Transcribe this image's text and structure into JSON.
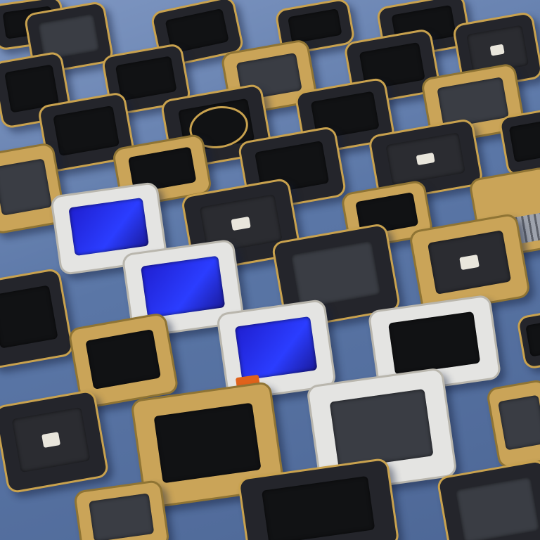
{
  "scene": {
    "description_label": "",
    "background_color": "#5f7aa6",
    "accent_colors": {
      "gold": "#d8b35a",
      "dark_body": "#24252b",
      "white_body": "#e4e4e2",
      "blue_screen": "#2b3dff",
      "orange_accent": "#e0621b"
    }
  },
  "devices": [
    {
      "kind": "dark",
      "screen": "black"
    },
    {
      "kind": "dark",
      "screen": "black"
    },
    {
      "kind": "gold",
      "screen": "gray"
    },
    {
      "kind": "dark",
      "screen": "chip"
    },
    {
      "kind": "dark",
      "screen": "ring"
    },
    {
      "kind": "white",
      "screen": "blue"
    },
    {
      "kind": "white",
      "screen": "blue"
    },
    {
      "kind": "white",
      "screen": "blue-orange"
    },
    {
      "kind": "gold",
      "screen": "keyboard"
    },
    {
      "kind": "gold",
      "screen": "black"
    }
  ]
}
